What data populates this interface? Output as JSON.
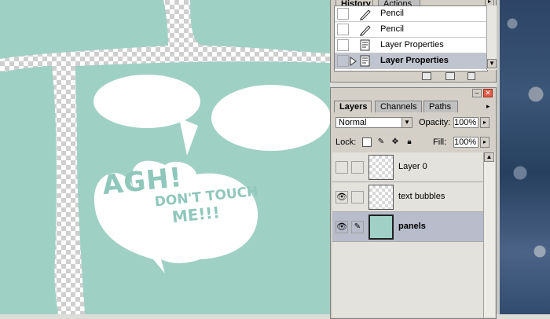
{
  "history": {
    "tabs": [
      "History",
      "Actions"
    ],
    "items": [
      {
        "label": "Pencil",
        "icon": "pencil-icon",
        "selected": false
      },
      {
        "label": "Pencil",
        "icon": "pencil-icon",
        "selected": false
      },
      {
        "label": "Layer Properties",
        "icon": "layer-properties-icon",
        "selected": false
      },
      {
        "label": "Layer Properties",
        "icon": "layer-properties-icon",
        "selected": true
      }
    ]
  },
  "layers": {
    "tabs": [
      "Layers",
      "Channels",
      "Paths"
    ],
    "blend_mode": "Normal",
    "opacity_label": "Opacity:",
    "opacity_value": "100%",
    "lock_label": "Lock:",
    "fill_label": "Fill:",
    "fill_value": "100%",
    "items": [
      {
        "name": "Layer 0",
        "visible": false,
        "selected": false
      },
      {
        "name": "text bubbles",
        "visible": true,
        "selected": false
      },
      {
        "name": "panels",
        "visible": true,
        "selected": true
      }
    ]
  },
  "canvas": {
    "bubble_text": [
      "AGH!",
      "DON'T TOUCH",
      "ME!!!"
    ],
    "panel_color": "#9fd0c4",
    "bubble_color": "#ffffff"
  }
}
